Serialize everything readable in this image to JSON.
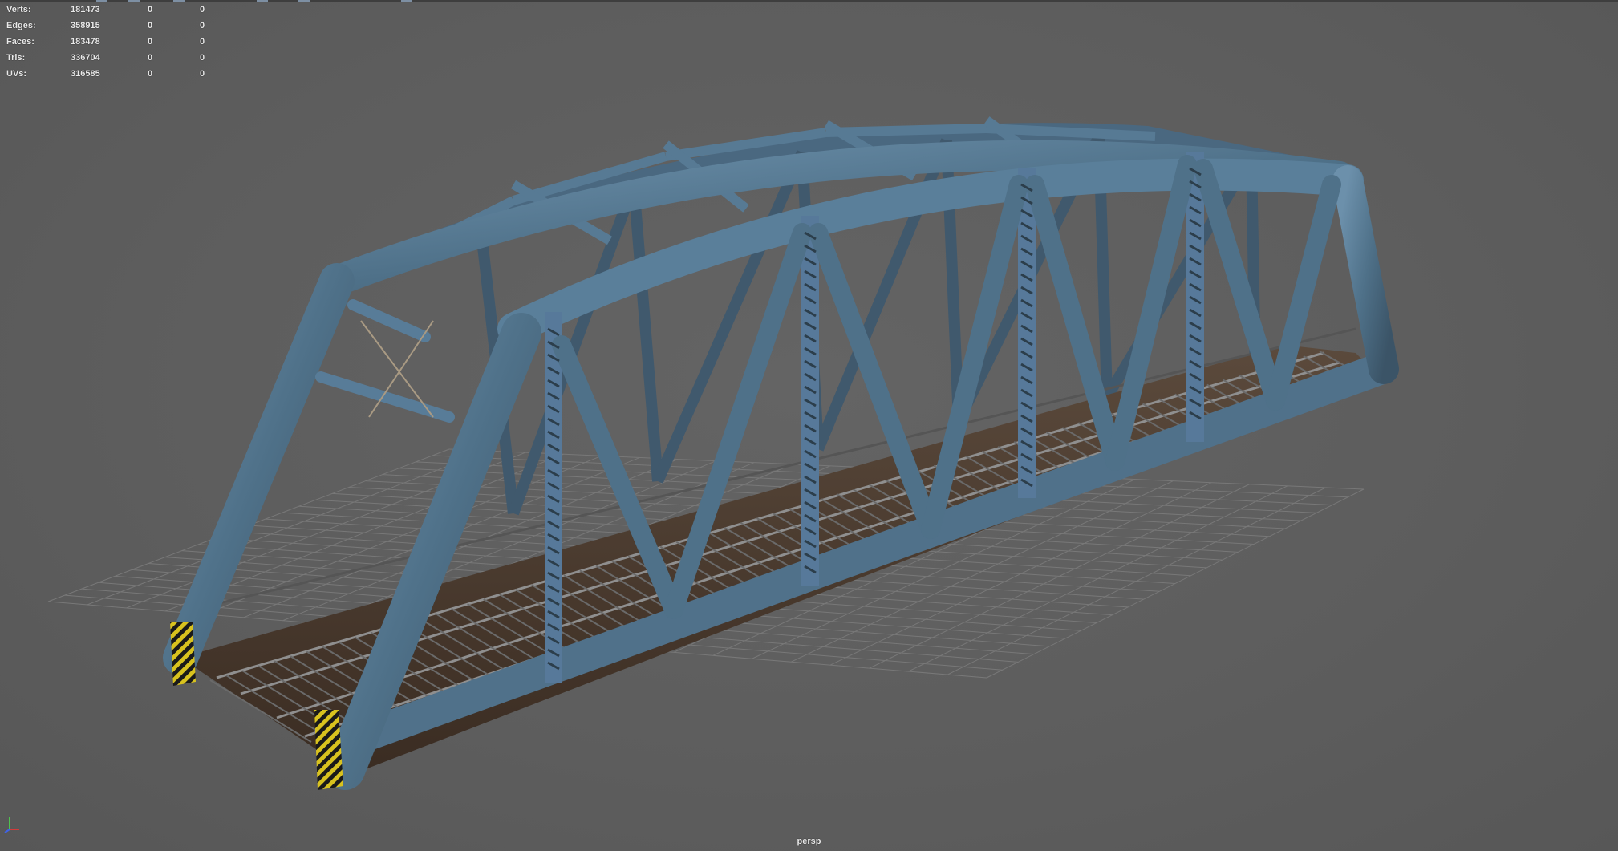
{
  "viewport": {
    "camera_name": "persp",
    "background_color": "#5f5f5f",
    "grid_color": "#7a7a7a",
    "model_color": "#5b7e98"
  },
  "heads_up_display": {
    "rows": [
      {
        "label": "Verts:",
        "values": [
          "181473",
          "0",
          "0"
        ]
      },
      {
        "label": "Edges:",
        "values": [
          "358915",
          "0",
          "0"
        ]
      },
      {
        "label": "Faces:",
        "values": [
          "183478",
          "0",
          "0"
        ]
      },
      {
        "label": "Tris:",
        "values": [
          "336704",
          "0",
          "0"
        ]
      },
      {
        "label": "UVs:",
        "values": [
          "316585",
          "0",
          "0"
        ]
      }
    ]
  },
  "axis_gizmo": {
    "x_color": "#d23b3b",
    "y_color": "#4fc24f",
    "z_color": "#3f63e8",
    "icon": "axis-orientation-icon"
  }
}
